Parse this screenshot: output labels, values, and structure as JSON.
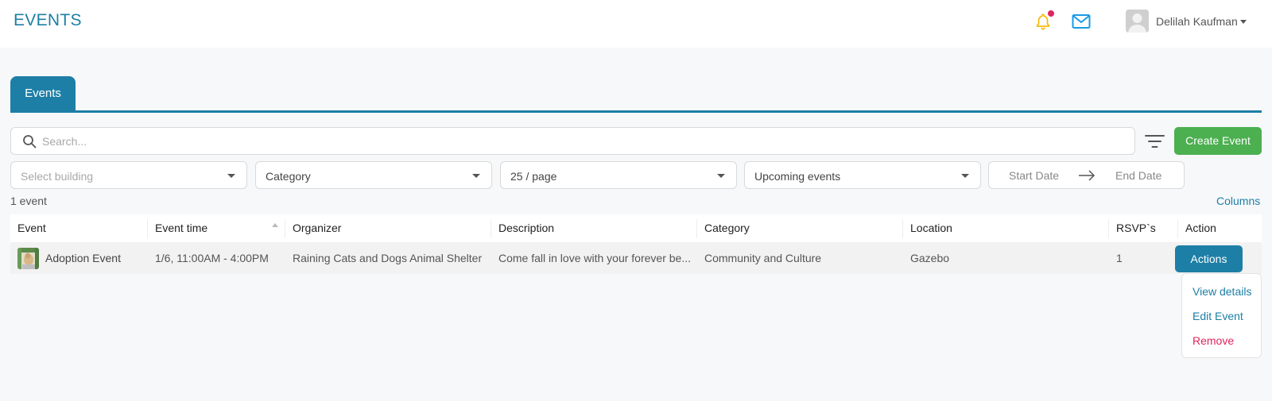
{
  "header": {
    "title": "EVENTS",
    "user_name": "Delilah Kaufman",
    "notification_color": "#f5b900",
    "notification_dot_color": "#e0245e",
    "mail_color": "#1a9be6"
  },
  "tabs": [
    {
      "label": "Events",
      "active": true
    }
  ],
  "toolbar": {
    "search_placeholder": "Search...",
    "create_label": "Create Event"
  },
  "filters": {
    "building_placeholder": "Select building",
    "category_value": "Category",
    "page_size_value": "25 / page",
    "events_value": "Upcoming events",
    "start_date_placeholder": "Start Date",
    "end_date_placeholder": "End Date"
  },
  "summary": {
    "count_text": "1 event",
    "columns_label": "Columns"
  },
  "table": {
    "headers": [
      "Event",
      "Event time",
      "Organizer",
      "Description",
      "Category",
      "Location",
      "RSVP`s",
      "Action"
    ],
    "rows": [
      {
        "event": "Adoption Event",
        "time": "1/6, 11:00AM - 4:00PM",
        "organizer": "Raining Cats and Dogs Animal Shelter",
        "description": "Come fall in love with your forever be...",
        "category": "Community and Culture",
        "location": "Gazebo",
        "rsvps": "1",
        "action_label": "Actions"
      }
    ]
  },
  "action_menu": {
    "items": [
      "View details",
      "Edit Event",
      "Remove"
    ]
  },
  "colors": {
    "accent": "#1d7fa6",
    "create": "#4caf50",
    "danger": "#e0245e"
  }
}
